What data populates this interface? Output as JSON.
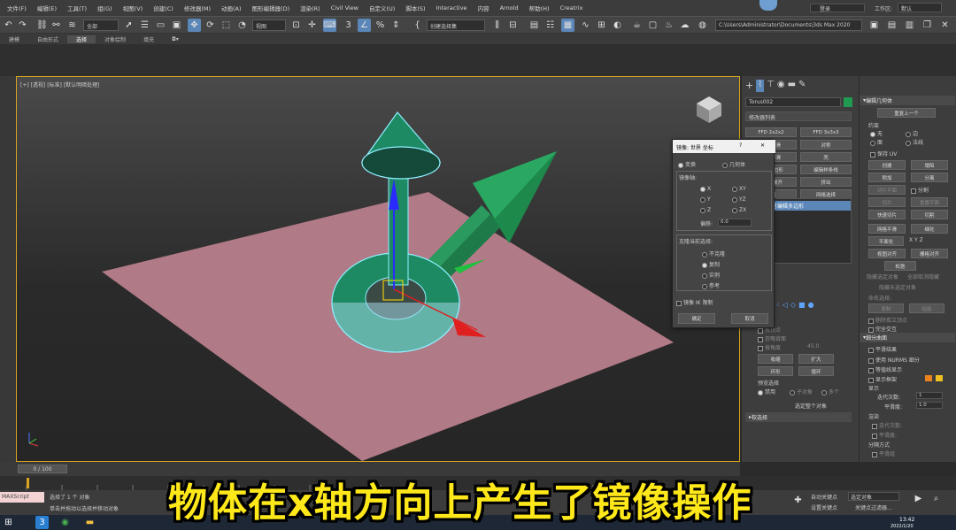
{
  "menu": [
    "文件(F)",
    "编辑(E)",
    "工具(T)",
    "组(G)",
    "视图(V)",
    "创建(C)",
    "修改器(M)",
    "动画(A)",
    "图形编辑器(D)",
    "渲染(R)",
    "Civil View",
    "自定义(U)",
    "脚本(S)",
    "Interactive",
    "内容",
    "Arnold",
    "帮助(H)",
    "Creatrix"
  ],
  "user": {
    "name": "登录",
    "workspace_label": "工作区:",
    "workspace_value": "默认"
  },
  "toolbar": {
    "selection_filter": "全部",
    "view_mode": "视图",
    "named_selection": "创建选择集",
    "path": "C:\\Users\\Administrator\\Documents\\3ds Max 2020"
  },
  "ribbon_tabs": [
    "建模",
    "自由形式",
    "选择",
    "对象绘制",
    "填充"
  ],
  "viewport": {
    "label": "[+] [透视] [标准] [默认明暗处理]"
  },
  "command_panel": {
    "object_name": "Torus002",
    "modifier_list": "修改器列表",
    "buttons": [
      "FFD 2x2x2",
      "FFD 3x3x3",
      "网格平滑",
      "对称",
      "涡轮平滑",
      "壳",
      "编辑多边形",
      "编辑样条线",
      "UVW 展开",
      "挤出",
      "车削",
      "网格选择"
    ],
    "stack_item": "可编辑多边形",
    "section_sel": "软选择",
    "labels": [
      "按顶点",
      "忽略背面",
      "按角度",
      "45.0",
      "收缩",
      "扩大",
      "环形",
      "循环",
      "预览选择",
      "禁用",
      "子对象",
      "多个",
      "选定整个对象"
    ]
  },
  "modify_panel": {
    "head1": "编辑几何体",
    "repeat_last": "重复上一个",
    "constraints": "约束",
    "constraint_opts": [
      "无",
      "边",
      "面",
      "法线"
    ],
    "preserve_uvs": "保持 UV",
    "create": "创建",
    "collapse": "塌陷",
    "attach": "附加",
    "detach": "分离",
    "slice_plane": "切片平面",
    "split": "分割",
    "slice": "切片",
    "reset_plane": "重置平面",
    "quickslice": "快速切片",
    "cut": "切割",
    "meshsmooth": "网格平滑",
    "tessellate": "细化",
    "make_planar": "平面化",
    "view_align": "视图对齐",
    "grid_align": "栅格对齐",
    "relax": "松弛",
    "hide_sel": "隐藏选定对象",
    "unhide_all": "全部取消隐藏",
    "hide_unsel": "隐藏未选定对象",
    "named_sel": "命名选择:",
    "copy": "复制",
    "paste": "粘贴",
    "delete_iso": "删除孤立顶点",
    "full_interact": "完全交互",
    "head2": "细分曲面",
    "smooth_result": "平滑结果",
    "use_nurms": "使用 NURMS 细分",
    "isoline": "等值线显示",
    "show_cage": "显示框架",
    "display": "显示",
    "iterations": "迭代次数:",
    "iterations_val": "1",
    "smoothness": "平滑度:",
    "smoothness_val": "1.0",
    "render": "渲染",
    "r_iterations": "迭代次数:",
    "r_smoothness": "平滑度:",
    "separate_by": "分隔方式",
    "smoothing_groups": "平滑组"
  },
  "dialog": {
    "title": "镜像: 世界 坐标",
    "help": "?",
    "close": "✕",
    "mode_transform": "变换",
    "mode_geometry": "几何体",
    "axis_group": "镜像轴:",
    "axes": [
      "X",
      "Y",
      "Z",
      "XY",
      "YZ",
      "ZX"
    ],
    "offset_label": "偏移:",
    "offset_value": "0.0",
    "clone_group": "克隆当前选择:",
    "clone_opts": [
      "不克隆",
      "复制",
      "实例",
      "参考"
    ],
    "mirror_ik": "镜像 IK 限制",
    "ok": "确定",
    "cancel": "取消"
  },
  "timeline": {
    "frame": "0 / 100"
  },
  "status": {
    "selected": "选择了 1 个 对象",
    "hint": "单击并拖动以选择并移动对象",
    "maxscript": "MAXScript",
    "autokey": "自动关键点",
    "setkey": "设置关键点",
    "selected_obj": "选定对象",
    "keyfilter": "关键点过滤器..."
  },
  "taskbar": {
    "time": "13:42",
    "date": "2022/1/20"
  },
  "caption": "物体在x轴方向上产生了镜像操作"
}
